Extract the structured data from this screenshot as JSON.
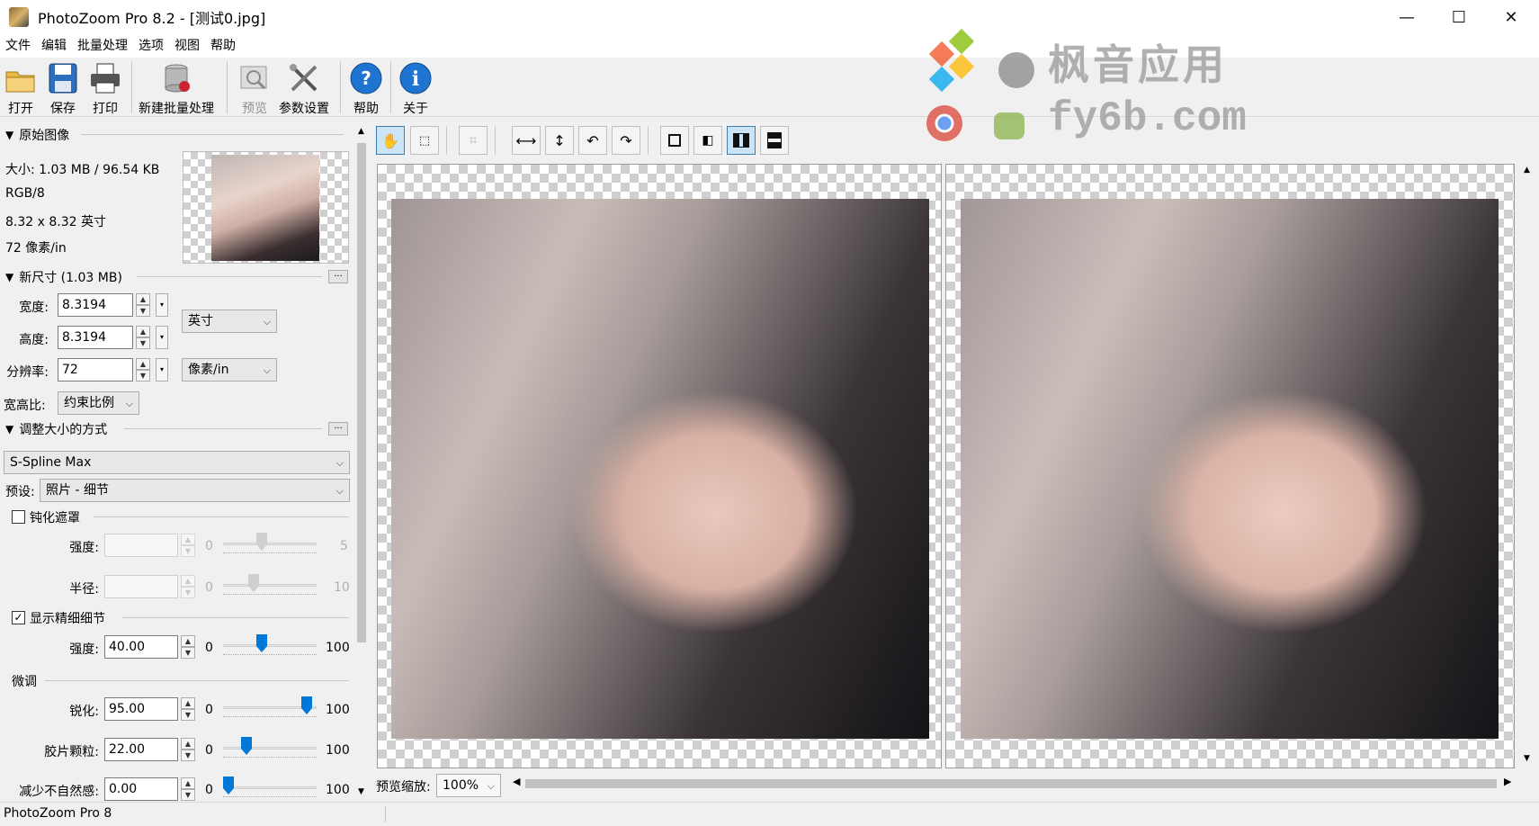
{
  "window": {
    "title": "PhotoZoom Pro 8.2 - [测试0.jpg]",
    "minimize": "—",
    "maximize": "☐",
    "close": "✕"
  },
  "menu": [
    "文件",
    "编辑",
    "批量处理",
    "选项",
    "视图",
    "帮助"
  ],
  "toolbar": {
    "open": "打开",
    "save": "保存",
    "print": "打印",
    "batch": "新建批量处理",
    "preview": "预览",
    "settings": "参数设置",
    "help": "帮助",
    "about": "关于"
  },
  "original": {
    "header": "原始图像",
    "size": "大小: 1.03 MB / 96.54 KB",
    "mode": "RGB/8",
    "dims": "8.32 x 8.32 英寸",
    "res": "72 像素/in"
  },
  "new_size": {
    "header": "新尺寸 (1.03 MB)",
    "width_label": "宽度:",
    "width_value": "8.3194",
    "height_label": "高度:",
    "height_value": "8.3194",
    "res_label": "分辨率:",
    "res_value": "72",
    "unit": "英寸",
    "res_unit": "像素/in",
    "aspect_label": "宽高比:",
    "aspect_value": "约束比例"
  },
  "resize_method": {
    "header": "调整大小的方式",
    "method": "S-Spline Max",
    "preset_label": "预设:",
    "preset_value": "照片 - 细节"
  },
  "unsharp": {
    "label": "钝化遮罩",
    "checked": false,
    "strength_label": "强度:",
    "strength_min": "0",
    "strength_max": "5",
    "strength_level": 0.4,
    "radius_label": "半径:",
    "radius_min": "0",
    "radius_max": "10",
    "radius_level": 0.3
  },
  "fine_detail": {
    "label": "显示精细细节",
    "checked": true,
    "check_mark": "✓",
    "strength_label": "强度:",
    "strength_value": "40.00",
    "min": "0",
    "max": "100",
    "level": 0.4
  },
  "tweak": {
    "header": "微调",
    "sharpen_label": "锐化:",
    "sharpen_value": "95.00",
    "sharpen_min": "0",
    "sharpen_max": "100",
    "sharpen_level": 0.95,
    "grain_label": "胶片颗粒:",
    "grain_value": "22.00",
    "grain_min": "0",
    "grain_max": "100",
    "grain_level": 0.22,
    "artifact_label": "减少不自然感:",
    "artifact_value": "0.00",
    "artifact_min": "0",
    "artifact_max": "100",
    "artifact_level": 0.0
  },
  "preview": {
    "zoom_label": "预览缩放:",
    "zoom_value": "100%"
  },
  "status": "PhotoZoom Pro 8",
  "watermark": {
    "brand": "枫音应用",
    "url": "fy6b.com"
  },
  "colors": {
    "accent": "#0078d7",
    "toggle_active": "#cce4f7"
  }
}
